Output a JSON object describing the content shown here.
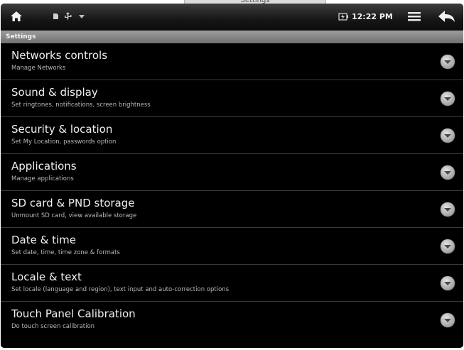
{
  "window": {
    "tab_label": "Settings"
  },
  "statusbar": {
    "time": "12:22 PM",
    "icons": [
      "home-icon",
      "sd-card-icon",
      "usb-icon",
      "signal-icon",
      "battery-icon",
      "menu-icon",
      "back-icon"
    ]
  },
  "header": {
    "title": "Settings"
  },
  "settings": {
    "items": [
      {
        "title": "Networks controls",
        "subtitle": "Manage Networks"
      },
      {
        "title": "Sound & display",
        "subtitle": "Set ringtones, notifications, screen brightness"
      },
      {
        "title": "Security & location",
        "subtitle": "Set My Location, passwords option"
      },
      {
        "title": "Applications",
        "subtitle": "Manage applications"
      },
      {
        "title": "SD card & PND storage",
        "subtitle": "Unmount SD card, view available storage"
      },
      {
        "title": "Date & time",
        "subtitle": "Set date, time, time zone & formats"
      },
      {
        "title": "Locale & text",
        "subtitle": "Set locale (language and region), text input and auto-correction options"
      },
      {
        "title": "Touch Panel Calibration",
        "subtitle": "Do touch screen calibration"
      }
    ]
  }
}
